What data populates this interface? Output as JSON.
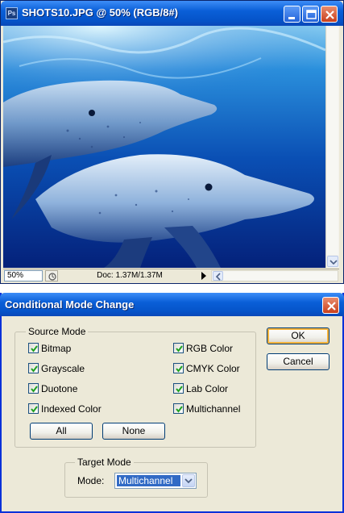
{
  "document_window": {
    "title": "SHOTS10.JPG @ 50% (RGB/8#)",
    "app_icon_text": "Ps",
    "zoom": "50%",
    "doc_info": "Doc: 1.37M/1.37M",
    "icons": [
      "photoshop-icon",
      "minimize-icon",
      "maximize-icon",
      "close-icon",
      "status-options-icon",
      "status-menu-arrow-icon",
      "scroll-down-arrow-icon",
      "scroll-left-arrow-icon"
    ],
    "image_subject": "dolphins underwater photo"
  },
  "dialog": {
    "title": "Conditional Mode Change",
    "source_mode": {
      "label": "Source Mode",
      "left_options": [
        {
          "label": "Bitmap",
          "checked": true
        },
        {
          "label": "Grayscale",
          "checked": true
        },
        {
          "label": "Duotone",
          "checked": true
        },
        {
          "label": "Indexed Color",
          "checked": true
        }
      ],
      "right_options": [
        {
          "label": "RGB Color",
          "checked": true
        },
        {
          "label": "CMYK Color",
          "checked": true
        },
        {
          "label": "Lab Color",
          "checked": true
        },
        {
          "label": "Multichannel",
          "checked": true
        }
      ],
      "all_button": "All",
      "none_button": "None"
    },
    "target_mode": {
      "label": "Target Mode",
      "mode_label": "Mode:",
      "selected": "Multichannel"
    },
    "ok_button": "OK",
    "cancel_button": "Cancel"
  },
  "colors": {
    "titlebar_blue": "#0553c8",
    "dialog_bg": "#ece9d8",
    "select_highlight": "#316ac5",
    "ok_focus": "#f8b33a"
  }
}
